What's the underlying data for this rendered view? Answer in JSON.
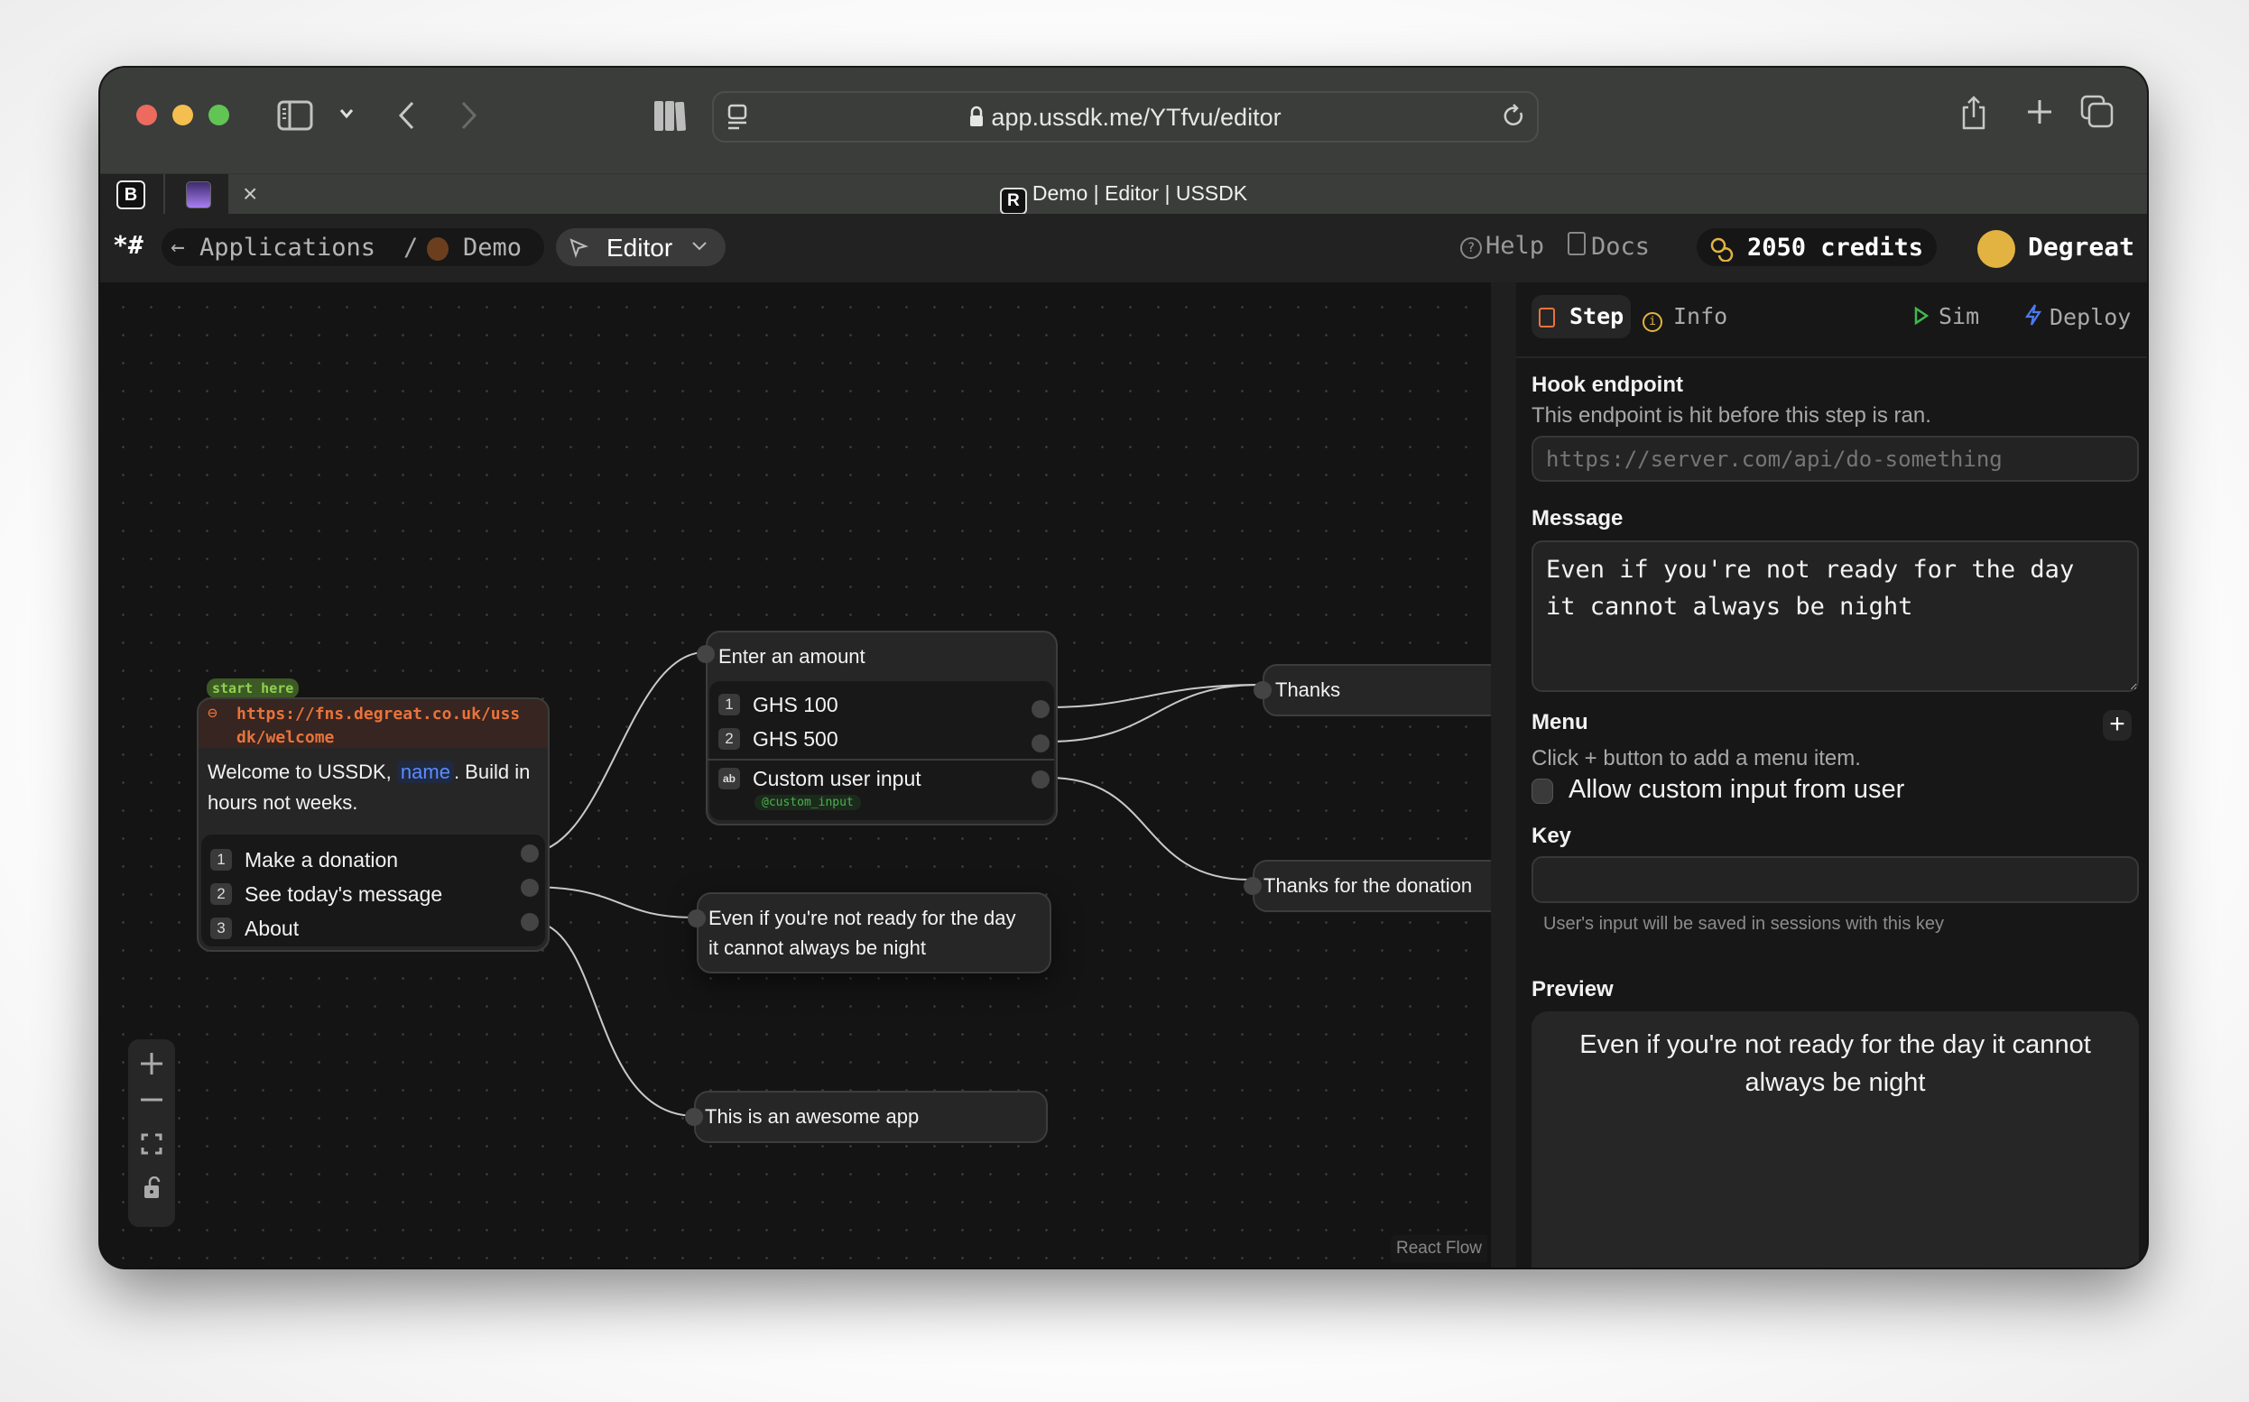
{
  "browser": {
    "url": "app.ussdk.me/YTfvu/editor",
    "tab_title": "Demo | Editor | USSDK",
    "traffic_lights": {
      "close": "#ec6a5e",
      "minimize": "#f4bf4f",
      "maximize": "#61c554"
    },
    "icons": [
      "sidebar-icon",
      "chevron-down-icon",
      "back-icon",
      "forward-icon",
      "library-icon",
      "page-menu-icon",
      "lock-icon",
      "reload-icon",
      "share-icon",
      "new-tab-icon",
      "tab-overview-icon"
    ],
    "tab_close_label": "×"
  },
  "appbar": {
    "logo": "*#",
    "breadcrumb_back": "Applications",
    "breadcrumb_sep": "/",
    "app_name": "Demo",
    "app_color": "#6b3f1d",
    "mode_label": "Editor",
    "help_label": "Help",
    "docs_label": "Docs",
    "credits_label": "2050 credits",
    "user_name": "Degreat",
    "user_color": "#e3b341"
  },
  "canvas": {
    "attribution": "React Flow",
    "controls": [
      "zoom-in",
      "zoom-out",
      "fit-view",
      "toggle-lock"
    ],
    "start_badge": "start here",
    "start_node": {
      "hook_url": "https://fns.degreat.co.uk/ussdk/welcome",
      "hook_url_line1": "https://fns.degreat.co.uk/uss",
      "hook_url_line2": "dk/welcome",
      "message_pre": "Welcome to USSDK,",
      "message_var": "name",
      "message_post": ". Build in",
      "message_line2": "hours not weeks.",
      "menu": [
        {
          "num": "1",
          "label": "Make a donation"
        },
        {
          "num": "2",
          "label": "See today's message"
        },
        {
          "num": "3",
          "label": "About"
        }
      ]
    },
    "amount_node": {
      "title": "Enter an amount",
      "menu": [
        {
          "num": "1",
          "label": "GHS 100"
        },
        {
          "num": "2",
          "label": "GHS 500"
        }
      ],
      "custom_input": {
        "icon": "ab",
        "label": "Custom user input",
        "key": "@custom_input"
      }
    },
    "message_nodes": {
      "thanks": "Thanks",
      "thanks_donation": "Thanks for the donation",
      "quote_line1": "Even if you're not ready for the day",
      "quote_line2": "it cannot always be night",
      "about": "This is an awesome app"
    },
    "edges": [
      {
        "from": "start.menu.1",
        "to": "amount_node"
      },
      {
        "from": "start.menu.2",
        "to": "quote_node"
      },
      {
        "from": "start.menu.3",
        "to": "about_node"
      },
      {
        "from": "amount.menu.1",
        "to": "thanks_node"
      },
      {
        "from": "amount.menu.2",
        "to": "thanks_node"
      },
      {
        "from": "amount.custom_input",
        "to": "thanks_donation_node"
      }
    ]
  },
  "panel": {
    "tabs": [
      {
        "label": "Step",
        "active": true,
        "color": "#e8733a"
      },
      {
        "label": "Info",
        "active": false,
        "color": "#e3b341"
      }
    ],
    "actions": [
      {
        "label": "Sim",
        "color": "#3fb950"
      },
      {
        "label": "Deploy",
        "color": "#4c7bf0"
      }
    ],
    "hook": {
      "label": "Hook endpoint",
      "description": "This endpoint is hit before this step is ran.",
      "placeholder": "https://server.com/api/do-something",
      "value": ""
    },
    "message": {
      "label": "Message",
      "value": "Even if you're not ready for the day\nit cannot always be night"
    },
    "menu": {
      "label": "Menu",
      "add_label": "+",
      "hint": "Click + button to add a menu item."
    },
    "custom_input": {
      "label": "Allow custom input from user",
      "checked": false
    },
    "key": {
      "label": "Key",
      "value": "",
      "hint": "User's input will be saved in sessions with this key"
    },
    "preview": {
      "label": "Preview",
      "text": "Even if you're not ready for the day it cannot always be night"
    }
  }
}
